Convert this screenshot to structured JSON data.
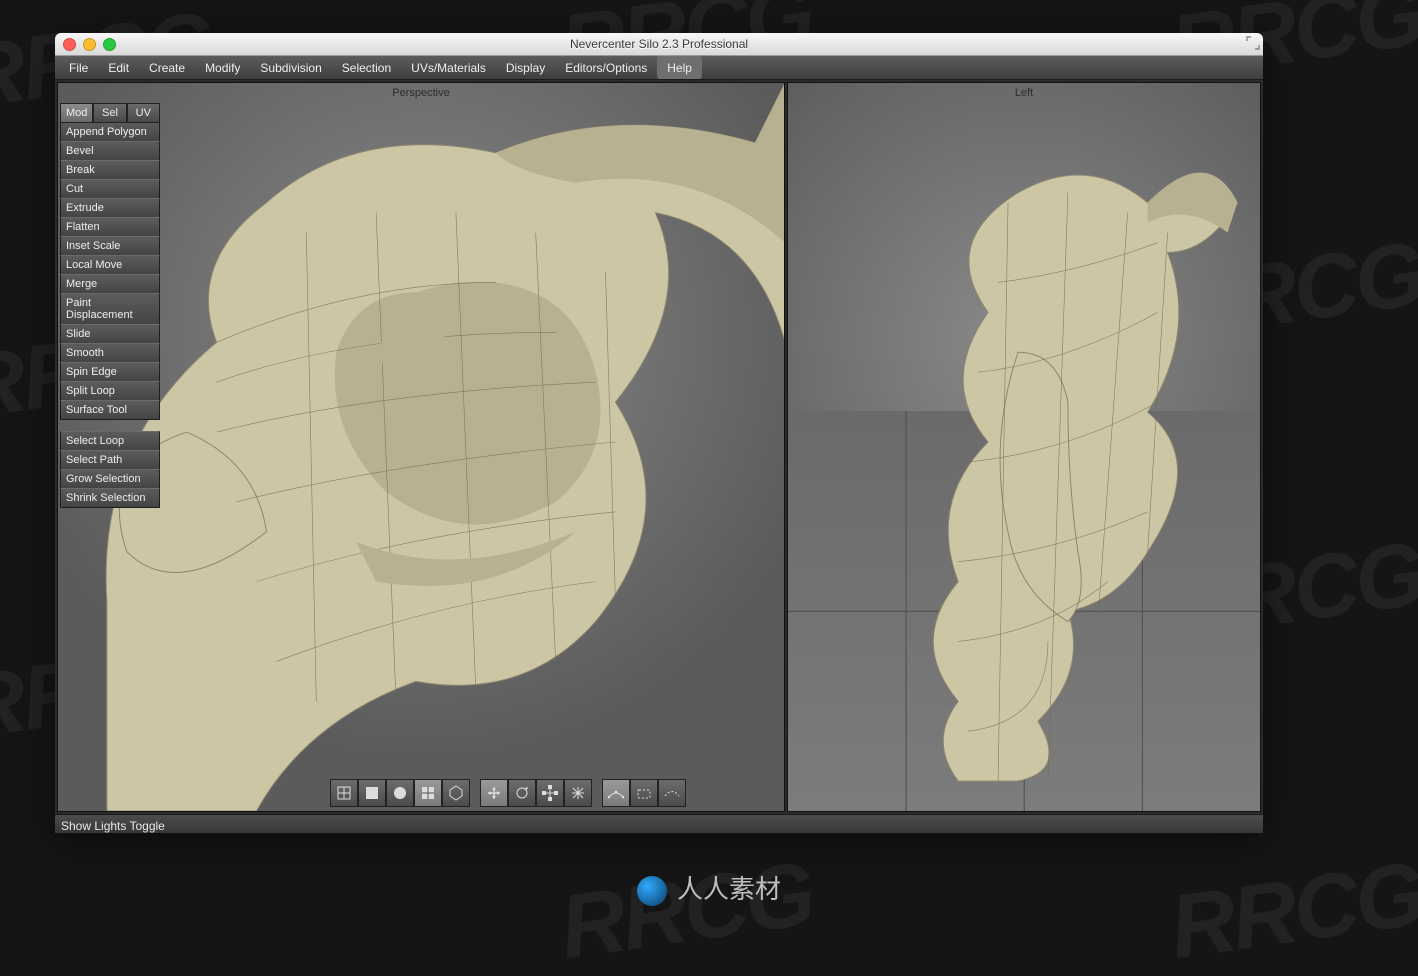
{
  "window": {
    "title": "Nevercenter Silo 2.3 Professional"
  },
  "menu": {
    "items": [
      "File",
      "Edit",
      "Create",
      "Modify",
      "Subdivision",
      "Selection",
      "UVs/Materials",
      "Display",
      "Editors/Options",
      "Help"
    ],
    "active_index": 9
  },
  "side_tabs": {
    "items": [
      "Mod",
      "Sel",
      "UV"
    ],
    "active_index": 0
  },
  "mod_tools": [
    "Append Polygon",
    "Bevel",
    "Break",
    "Cut",
    "Extrude",
    "Flatten",
    "Inset Scale",
    "Local Move",
    "Merge",
    "Paint Displacement",
    "Slide",
    "Smooth",
    "Spin Edge",
    "Split Loop",
    "Surface Tool"
  ],
  "sel_tools": [
    "Select Loop",
    "Select Path",
    "Grow Selection",
    "Shrink Selection"
  ],
  "viewports": {
    "perspective_label": "Perspective",
    "left_label": "Left"
  },
  "bottom_tools": {
    "shading": [
      "wireframe",
      "flat-shade",
      "smooth-shade",
      "shade-wire",
      "ghosted"
    ],
    "shading_active": 3,
    "manip": [
      "manip-move",
      "manip-rotate",
      "manip-scale",
      "manip-universal"
    ],
    "manip_active": 0,
    "snap": [
      "snap-grid",
      "snap-edge",
      "snap-curve"
    ],
    "snap_active": 0
  },
  "status": {
    "text": "Show Lights Toggle"
  },
  "footer": {
    "brand": "人人素材"
  },
  "watermark": {
    "text": "RRCG"
  }
}
